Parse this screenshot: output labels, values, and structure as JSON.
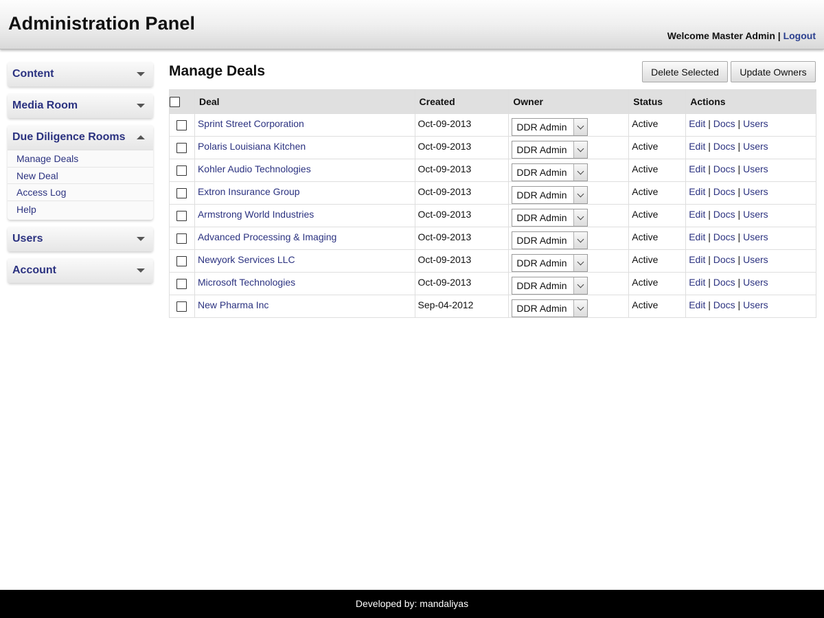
{
  "header": {
    "title": "Administration Panel",
    "welcome_text": "Welcome Master Admin",
    "separator": "|",
    "logout_label": "Logout"
  },
  "sidebar": {
    "groups": [
      {
        "label": "Content",
        "icon": "chevron-down-icon",
        "expanded": false
      },
      {
        "label": "Media Room",
        "icon": "chevron-down-icon",
        "expanded": false
      },
      {
        "label": "Due Diligence Rooms",
        "icon": "chevron-up-icon",
        "expanded": true,
        "items": [
          "Manage Deals",
          "New Deal",
          "Access Log",
          "Help"
        ]
      },
      {
        "label": "Users",
        "icon": "chevron-down-icon",
        "expanded": false
      },
      {
        "label": "Account",
        "icon": "chevron-down-icon",
        "expanded": false
      }
    ]
  },
  "main": {
    "page_title": "Manage Deals",
    "delete_button": "Delete Selected",
    "update_button": "Update Owners",
    "table": {
      "columns": [
        "Deal",
        "Created",
        "Owner",
        "Status",
        "Actions"
      ],
      "action_labels": [
        "Edit",
        "Docs",
        "Users"
      ],
      "rows": [
        {
          "deal": "Sprint Street Corporation",
          "created": "Oct-09-2013",
          "owner": "DDR Admin",
          "status": "Active"
        },
        {
          "deal": "Polaris Louisiana Kitchen",
          "created": "Oct-09-2013",
          "owner": "DDR Admin",
          "status": "Active"
        },
        {
          "deal": "Kohler Audio Technologies",
          "created": "Oct-09-2013",
          "owner": "DDR Admin",
          "status": "Active"
        },
        {
          "deal": "Extron Insurance Group",
          "created": "Oct-09-2013",
          "owner": "DDR Admin",
          "status": "Active"
        },
        {
          "deal": "Armstrong World Industries",
          "created": "Oct-09-2013",
          "owner": "DDR Admin",
          "status": "Active"
        },
        {
          "deal": "Advanced Processing & Imaging",
          "created": "Oct-09-2013",
          "owner": "DDR Admin",
          "status": "Active"
        },
        {
          "deal": "Newyork Services LLC",
          "created": "Oct-09-2013",
          "owner": "DDR Admin",
          "status": "Active"
        },
        {
          "deal": "Microsoft Technologies",
          "created": "Oct-09-2013",
          "owner": "DDR Admin",
          "status": "Active"
        },
        {
          "deal": "New Pharma Inc",
          "created": "Sep-04-2012",
          "owner": "DDR Admin",
          "status": "Active"
        }
      ]
    }
  },
  "footer": {
    "text": "Developed by: mandaliyas"
  },
  "colors": {
    "link": "#2b3280",
    "footer_bg": "#000000",
    "header_bg": "#ececec"
  }
}
